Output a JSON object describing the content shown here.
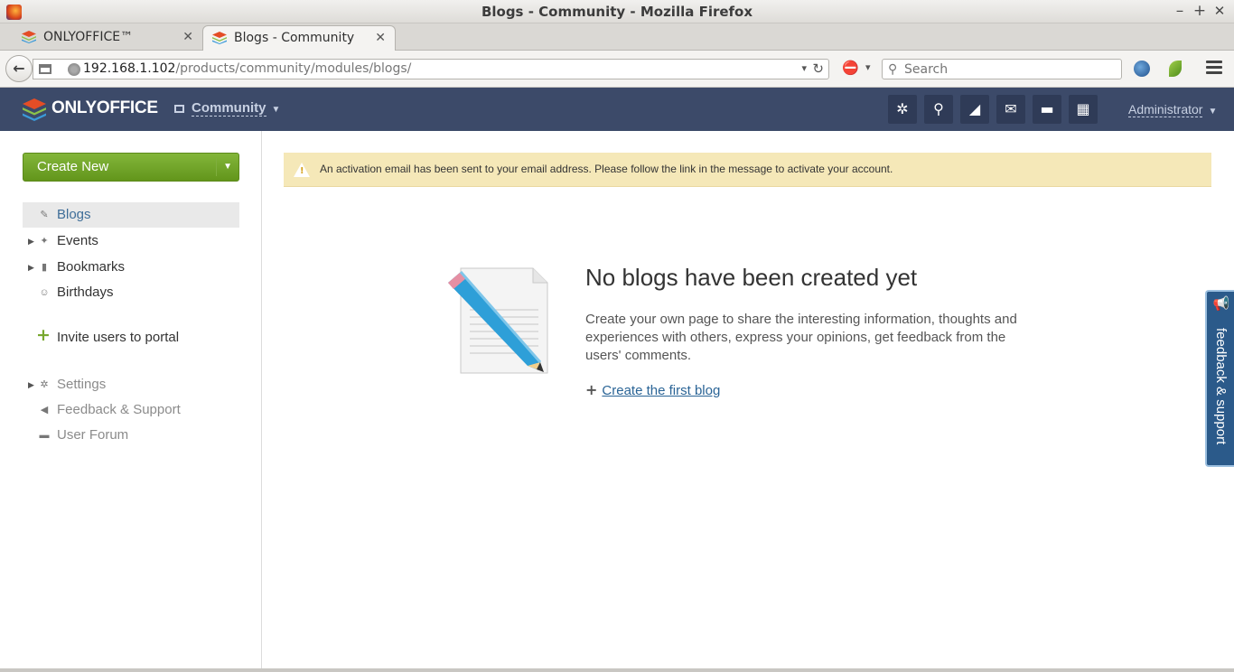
{
  "window": {
    "title": "Blogs - Community - Mozilla Firefox",
    "controls": {
      "minimize": "–",
      "maximize": "+",
      "close": "✕"
    }
  },
  "tabs": [
    {
      "label": "ONLYOFFICE™",
      "close": "✕"
    },
    {
      "label": "Blogs - Community",
      "close": "✕"
    }
  ],
  "tabbar": {
    "new_tab": "+"
  },
  "navbar": {
    "back": "←",
    "url_host": "192.168.1.102",
    "url_path": "/products/community/modules/blogs/",
    "reload": "↻",
    "dropdown": "▾",
    "search_placeholder": "Search"
  },
  "header": {
    "logo_text": "ONLYOFFICE",
    "module": "Community",
    "toolbar_icons": [
      "gear-icon",
      "search-icon",
      "feed-icon",
      "mail-icon",
      "chat-icon",
      "calendar-icon"
    ],
    "toolbar_glyphs": [
      "✲",
      "⚲",
      "◢",
      "✉",
      "▬",
      "▦"
    ],
    "user": "Administrator",
    "colors": {
      "bar": "#3c4a69",
      "button": "#2f3b57"
    }
  },
  "sidebar": {
    "create_new": "Create New",
    "items": [
      {
        "label": "Blogs",
        "icon": "✎",
        "selected": true
      },
      {
        "label": "Events",
        "icon": "✦",
        "expandable": true
      },
      {
        "label": "Bookmarks",
        "icon": "▮",
        "expandable": true
      },
      {
        "label": "Birthdays",
        "icon": "☺"
      }
    ],
    "invite": "Invite users to portal",
    "links": [
      {
        "label": "Settings",
        "icon": "✲",
        "expandable": true
      },
      {
        "label": "Feedback & Support",
        "icon": "◀"
      },
      {
        "label": "User Forum",
        "icon": "▬"
      }
    ],
    "colors": {
      "create_button": "#72a42a",
      "selected_text": "#3e6d98"
    }
  },
  "main": {
    "alert": "An activation email has been sent to your email address. Please follow the link in the message to activate your account.",
    "empty_title": "No blogs have been created yet",
    "empty_desc": "Create your own page to share the interesting information, thoughts and experiences with others, express your opinions, get feedback from the users' comments.",
    "create_link": "Create the first blog",
    "colors": {
      "alert_bg": "#f5e8b8",
      "link": "#2a6496"
    }
  },
  "feedback_tab": {
    "label": "feedback & support",
    "color": "#2b5a8a"
  }
}
